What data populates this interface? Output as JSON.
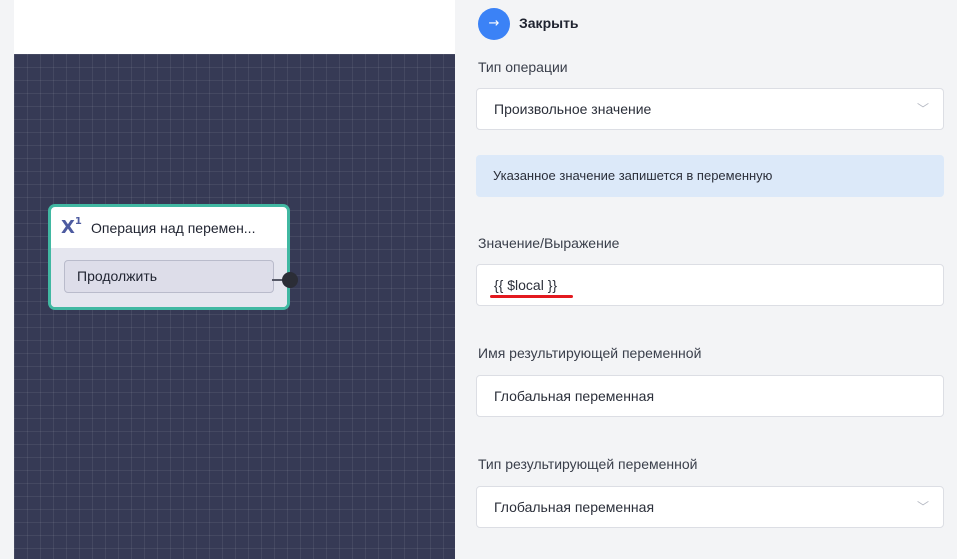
{
  "canvas": {
    "node": {
      "icon": "X",
      "icon_sup": "1",
      "title": "Операция над перемен...",
      "button_label": "Продолжить"
    }
  },
  "panel": {
    "close_icon": "→",
    "close_label": "Закрыть",
    "operation_type": {
      "label": "Тип операции",
      "value": "Произвольное значение"
    },
    "info_text": "Указанное значение запишется в переменную",
    "expression": {
      "label": "Значение/Выражение",
      "value": "{{ $local }}"
    },
    "result_name": {
      "label": "Имя результирующей переменной",
      "value": "Глобальная переменная"
    },
    "result_type": {
      "label": "Тип результирующей переменной",
      "value": "Глобальная переменная"
    },
    "chevron": "﹀",
    "colors": {
      "accent": "#3b82f6",
      "node_border": "#41b8a2",
      "canvas": "#363a55",
      "highlight_underline": "#e3191f",
      "info_bg": "#dce9f9"
    }
  }
}
